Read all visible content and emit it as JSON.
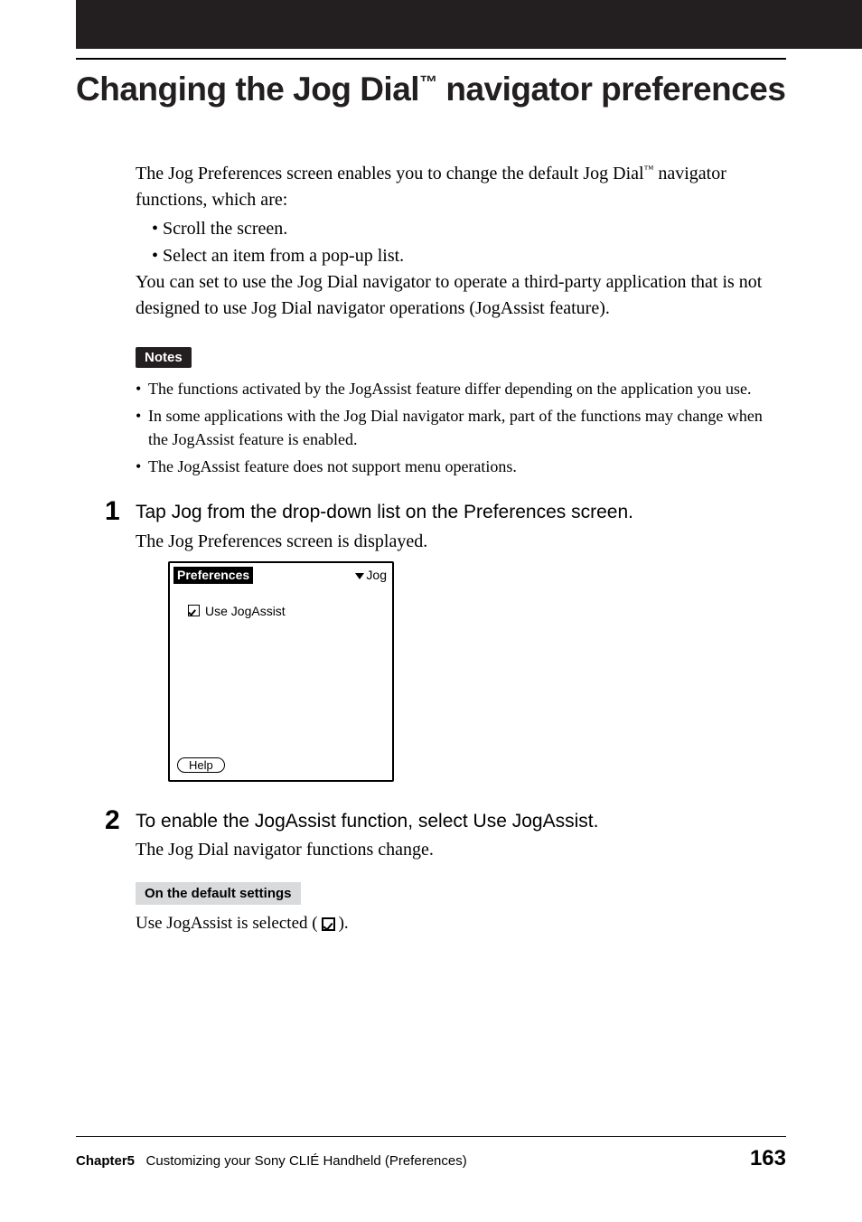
{
  "title": {
    "prefix": "Changing the Jog Dial",
    "tm": "™",
    "suffix": " navigator preferences"
  },
  "intro": {
    "line1_prefix": "The Jog Preferences screen enables you to change the default Jog Dial",
    "tm": "™",
    "line2": "navigator functions, which are:"
  },
  "bullets": [
    "Scroll the screen.",
    "Select an item from a pop-up list."
  ],
  "intro2": " You can set to use the Jog Dial navigator to operate a third-party application that is not designed to use Jog Dial navigator operations (JogAssist feature).",
  "notes_label": "Notes",
  "notes": [
    "The functions activated by the JogAssist feature differ depending on the application you use.",
    "In some applications with the Jog Dial navigator mark, part of the functions may change when the JogAssist feature is enabled.",
    "The JogAssist feature does not support menu operations."
  ],
  "steps": [
    {
      "num": "1",
      "title": "Tap Jog from the drop-down list on the Preferences screen.",
      "sub": "The Jog Preferences screen is displayed."
    },
    {
      "num": "2",
      "title": "To enable the JogAssist function, select Use JogAssist.",
      "sub": "The Jog Dial navigator functions change."
    }
  ],
  "screenshot": {
    "header": "Preferences",
    "dropdown": "Jog",
    "checkbox_label": "Use JogAssist",
    "help_button": "Help"
  },
  "default_settings": {
    "label": "On the default settings",
    "text_prefix": "Use JogAssist is selected (",
    "text_suffix": ")."
  },
  "footer": {
    "chapter": "Chapter5",
    "chapter_text": "Customizing your Sony CLIÉ Handheld (Preferences)",
    "page": "163"
  }
}
